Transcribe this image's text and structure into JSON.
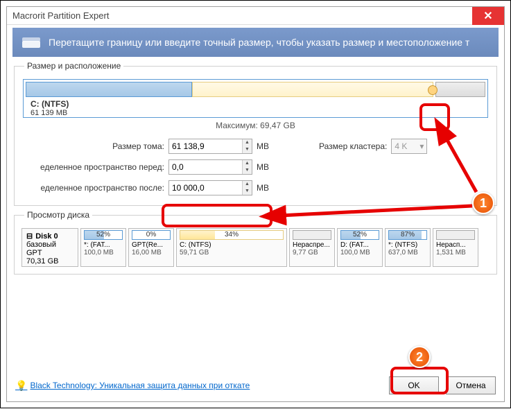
{
  "window": {
    "title": "Macrorit Partition Expert"
  },
  "banner": {
    "text": "Перетащите границу или введите точный размер, чтобы указать размер и местоположение т"
  },
  "size_group": {
    "legend": "Размер и расположение",
    "partition_name": "C: (NTFS)",
    "partition_size": "61 139 MB",
    "max_label": "Максимум: 69,47 GB",
    "volume_size_label": "Размер тома:",
    "volume_size_value": "61 138,9",
    "unit": "MB",
    "space_before_label": "еделенное пространство перед:",
    "space_before_value": "0,0",
    "space_after_label": "еделенное пространство после:",
    "space_after_value": "10 000,0",
    "cluster_label": "Размер кластера:",
    "cluster_value": "4 K"
  },
  "preview_group": {
    "legend": "Просмотр диска",
    "disk": {
      "name": "Disk 0",
      "type": "базовый GPT",
      "size": "70,31 GB"
    },
    "parts": [
      {
        "pct": "52%",
        "name": "*: (FAT...",
        "size": "100,0 MB",
        "fill": 52,
        "cls": ""
      },
      {
        "pct": "0%",
        "name": "GPT(Re...",
        "size": "16,00 MB",
        "fill": 0,
        "cls": ""
      },
      {
        "pct": "34%",
        "name": "C: (NTFS)",
        "size": "59,71 GB",
        "fill": 34,
        "cls": "ntfs",
        "wide": true
      },
      {
        "pct": "",
        "name": "Нераспре...",
        "size": "9,77 GB",
        "fill": 0,
        "cls": "unalloc"
      },
      {
        "pct": "52%",
        "name": "D: (FAT...",
        "size": "100,0 MB",
        "fill": 52,
        "cls": ""
      },
      {
        "pct": "87%",
        "name": "*: (NTFS)",
        "size": "637,0 MB",
        "fill": 87,
        "cls": ""
      },
      {
        "pct": "",
        "name": "Нерасп...",
        "size": "1,531 MB",
        "fill": 0,
        "cls": "unalloc"
      }
    ]
  },
  "footer": {
    "link": "Black Technology: Уникальная защита данных при откате",
    "ok": "OK",
    "cancel": "Отмена"
  },
  "annotations": {
    "step1": "1",
    "step2": "2"
  }
}
